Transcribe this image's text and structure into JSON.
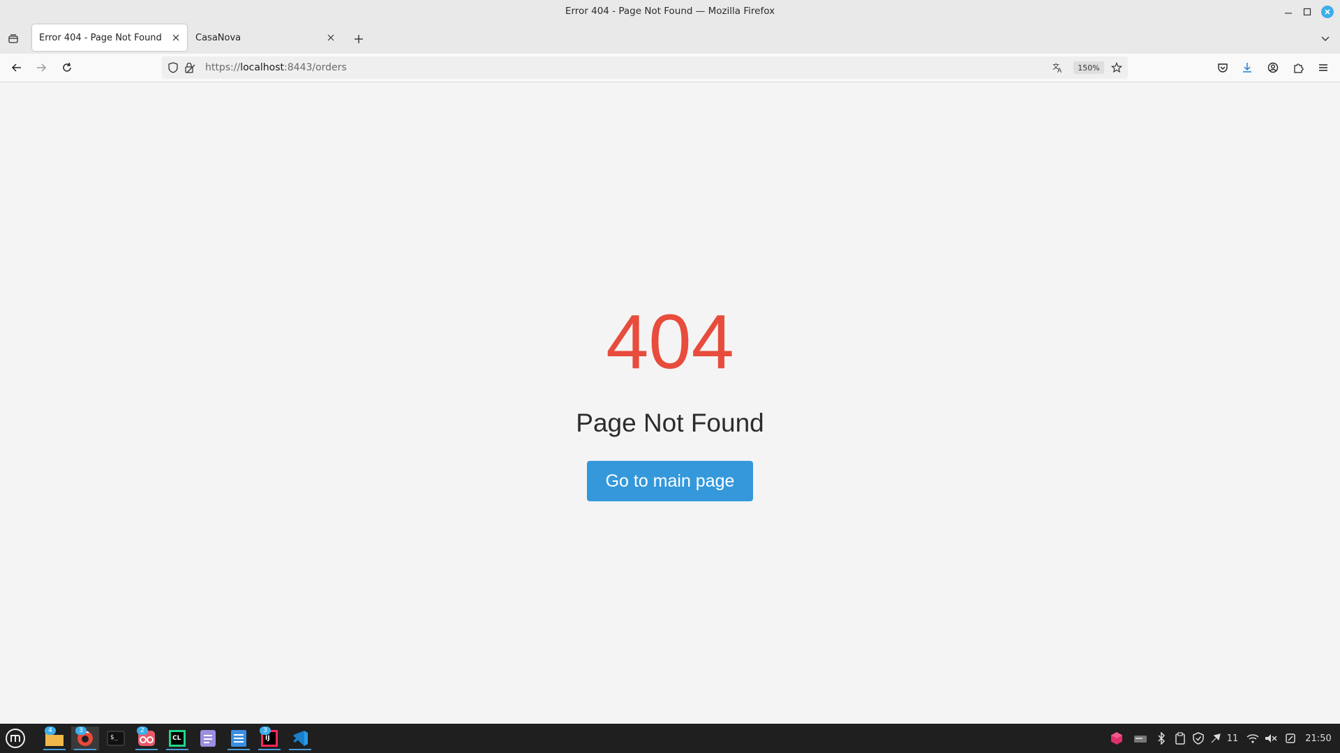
{
  "window": {
    "title": "Error 404 - Page Not Found — Mozilla Firefox"
  },
  "tabs": [
    {
      "label": "Error 404 - Page Not Found",
      "active": true
    },
    {
      "label": "CasaNova",
      "active": false
    }
  ],
  "urlbar": {
    "scheme": "https://",
    "host": "localhost",
    "rest": ":8443/orders",
    "zoom": "150%"
  },
  "page": {
    "code": "404",
    "message": "Page Not Found",
    "button_label": "Go to main page",
    "colors": {
      "code": "#e74c3c",
      "button": "#3498db",
      "background": "#f4f4f4"
    }
  },
  "taskbar": {
    "apps": [
      {
        "name": "menu-icon"
      },
      {
        "name": "files-icon",
        "badge": "4"
      },
      {
        "name": "browser-icon",
        "badge": "3"
      },
      {
        "name": "terminal-icon"
      },
      {
        "name": "viewer-icon",
        "badge": "2"
      },
      {
        "name": "clion-icon"
      },
      {
        "name": "text-editor-icon"
      },
      {
        "name": "writer-icon"
      },
      {
        "name": "intellij-icon",
        "badge": "3"
      },
      {
        "name": "vscode-icon"
      }
    ],
    "tray": {
      "notifications_count": "11",
      "clock": "21:50"
    }
  }
}
